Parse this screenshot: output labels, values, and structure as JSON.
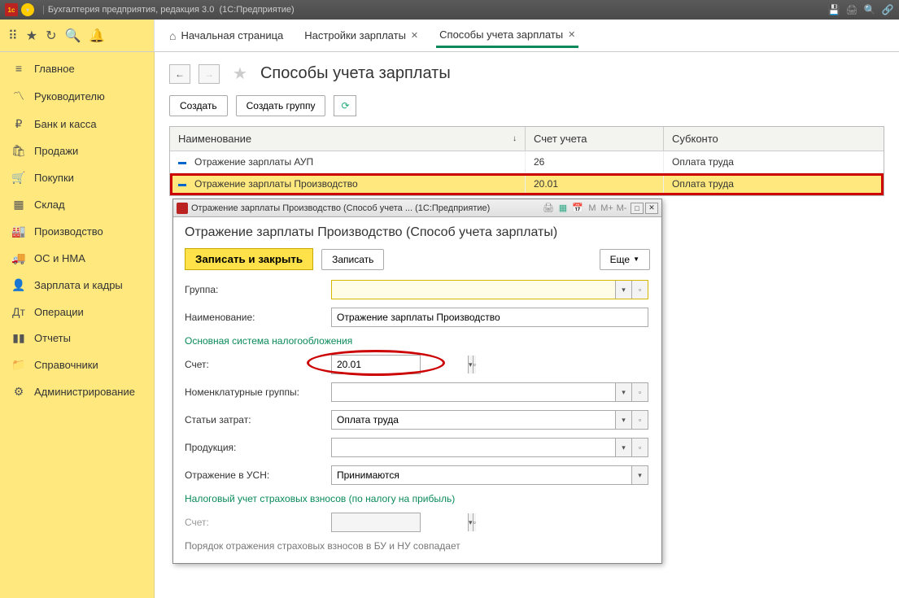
{
  "titleBar": {
    "appName": "Бухгалтерия предприятия, редакция 3.0",
    "platform": "(1С:Предприятие)"
  },
  "tabs": {
    "home": "Начальная страница",
    "t1": "Настройки зарплаты",
    "t2": "Способы учета зарплаты"
  },
  "sidebar": {
    "items": [
      {
        "label": "Главное"
      },
      {
        "label": "Руководителю"
      },
      {
        "label": "Банк и касса"
      },
      {
        "label": "Продажи"
      },
      {
        "label": "Покупки"
      },
      {
        "label": "Склад"
      },
      {
        "label": "Производство"
      },
      {
        "label": "ОС и НМА"
      },
      {
        "label": "Зарплата и кадры"
      },
      {
        "label": "Операции"
      },
      {
        "label": "Отчеты"
      },
      {
        "label": "Справочники"
      },
      {
        "label": "Администрирование"
      }
    ]
  },
  "page": {
    "title": "Способы учета зарплаты",
    "create": "Создать",
    "createGroup": "Создать группу"
  },
  "table": {
    "colName": "Наименование",
    "colAccount": "Счет учета",
    "colSub": "Субконто",
    "rows": [
      {
        "name": "Отражение зарплаты АУП",
        "acc": "26",
        "sub": "Оплата труда"
      },
      {
        "name": "Отражение зарплаты Производство",
        "acc": "20.01",
        "sub": "Оплата труда"
      }
    ]
  },
  "dialog": {
    "title": "Отражение зарплаты Производство (Способ учета ...",
    "platform": "(1С:Предприятие)",
    "header": "Отражение зарплаты Производство (Способ учета зарплаты)",
    "saveClose": "Записать и закрыть",
    "save": "Записать",
    "more": "Еще",
    "group": "Группа:",
    "groupVal": "",
    "name": "Наименование:",
    "nameVal": "Отражение зарплаты Производство",
    "taxHeader": "Основная система налогообложения",
    "account": "Счет:",
    "accountVal": "20.01",
    "nomGroups": "Номенклатурные группы:",
    "nomGroupsVal": "",
    "costItems": "Статьи затрат:",
    "costItemsVal": "Оплата труда",
    "production": "Продукция:",
    "productionVal": "",
    "usn": "Отражение в УСН:",
    "usnVal": "Принимаются",
    "insHeader": "Налоговый учет страховых взносов (по налогу на прибыль)",
    "account2": "Счет:",
    "note": "Порядок отражения страховых взносов в БУ и НУ совпадает"
  }
}
